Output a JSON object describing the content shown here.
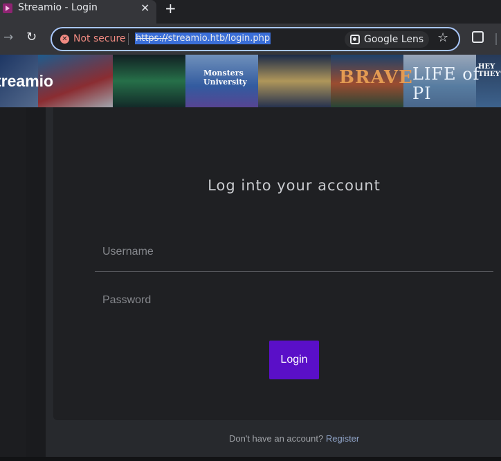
{
  "browser": {
    "tab_title": "Streamio - Login",
    "tab_close": "✕",
    "new_tab": "+",
    "security_label": "Not secure",
    "url_scheme": "https://",
    "url_rest": "streamio.htb/login.php",
    "lens_label": "Google Lens",
    "icons": {
      "forward": "forward-arrow-icon",
      "reload": "reload-icon",
      "security": "not-secure-icon",
      "lens": "google-lens-icon",
      "star": "bookmark-star-icon",
      "extensions": "extensions-icon"
    }
  },
  "site": {
    "title": "treamio",
    "banner_posters": [
      "Monsters University",
      "BRAVE",
      "LIFE of PI",
      "HEY THEY'RE"
    ]
  },
  "login": {
    "heading": "Log into your account",
    "username_placeholder": "Username",
    "password_placeholder": "Password",
    "button_label": "Login"
  },
  "footer": {
    "prompt": "Don't have an account?",
    "link": "Register"
  },
  "colors": {
    "accent": "#5a0fc8",
    "not_secure": "#f28b82",
    "omnibox_border": "#a8c7fa"
  }
}
